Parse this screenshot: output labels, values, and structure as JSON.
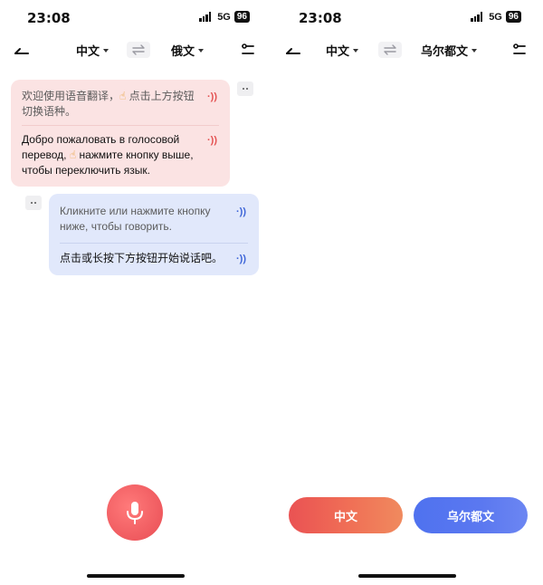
{
  "left_screen": {
    "status": {
      "time": "23:08",
      "network": "5G",
      "battery": "96"
    },
    "nav": {
      "source_lang": "中文",
      "target_lang": "俄文"
    },
    "bubble_top": {
      "line1_a": "欢迎使用语音翻译，",
      "line1_b": "点击上方按钮切换语种。",
      "line2_a": "Добро пожаловать в голосовой перевод,",
      "line2_b": "нажмите кнопку выше, чтобы переключить язык."
    },
    "bubble_bottom": {
      "line1": "Кликните или нажмите кнопку ниже, чтобы говорить.",
      "line2": "点击或长按下方按钮开始说话吧。"
    }
  },
  "right_screen": {
    "status": {
      "time": "23:08",
      "network": "5G",
      "battery": "96"
    },
    "nav": {
      "source_lang": "中文",
      "target_lang": "乌尔都文"
    },
    "buttons": {
      "left_label": "中文",
      "right_label": "乌尔都文"
    }
  },
  "icons": {
    "back": "back-arrow-icon",
    "swap": "swap-arrows-icon",
    "settings": "settings-sliders-icon",
    "speaker": "speaker-wave-icon",
    "copy": "copy-icon",
    "hand": "pointing-hand-emoji",
    "mic": "microphone-icon"
  },
  "colors": {
    "pink_bubble": "#fbe3e3",
    "blue_bubble": "#e1e8fb",
    "mic_red": "#ef5a5f",
    "pill_red": "#ea5253",
    "pill_blue": "#4f72ef"
  }
}
